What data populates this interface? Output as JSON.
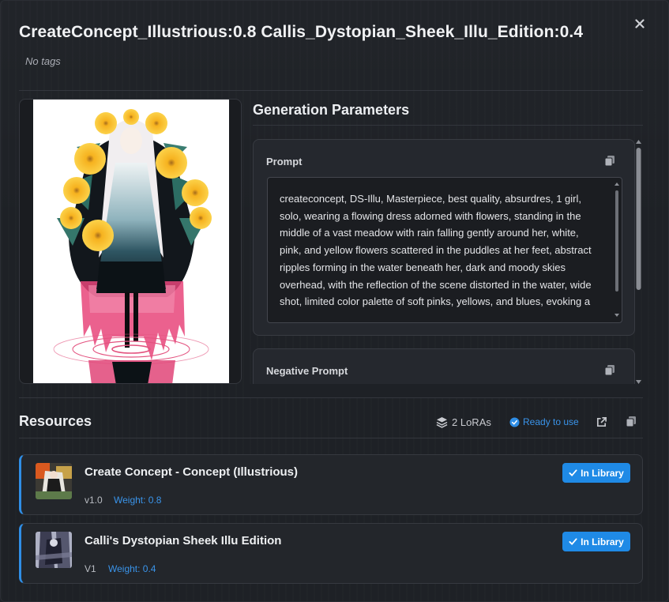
{
  "header": {
    "title": "CreateConcept_Illustrious:0.8 Callis_Dystopian_Sheek_Illu_Edition:0.4",
    "tags_text": "No tags"
  },
  "params": {
    "section_title": "Generation Parameters",
    "prompt_label": "Prompt",
    "prompt_text": "createconcept, DS-Illu, Masterpiece, best quality, absurdres, 1 girl, solo, wearing a flowing dress adorned with flowers, standing in the middle of a vast meadow with rain falling gently around her, white, pink, and yellow flowers scattered in the puddles at her feet, abstract ripples forming in the water beneath her, dark and moody skies overhead, with the reflection of the scene distorted in the water, wide shot, limited color palette of soft pinks, yellows, and blues, evoking a",
    "negative_label": "Negative Prompt"
  },
  "resources": {
    "section_title": "Resources",
    "lora_count": "2 LoRAs",
    "status": "Ready to use",
    "items": [
      {
        "name": "Create Concept - Concept (Illustrious)",
        "version": "v1.0",
        "weight": "Weight: 0.8",
        "library_label": "In Library"
      },
      {
        "name": "Calli's Dystopian Sheek Illu Edition",
        "version": "V1",
        "weight": "Weight: 0.4",
        "library_label": "In Library"
      }
    ]
  },
  "icons": {
    "close": "close-icon",
    "copy": "copy-icon",
    "layers": "layers-icon",
    "check_circle": "check-circle-icon",
    "external_link": "external-link-icon",
    "check": "check-icon"
  },
  "colors": {
    "accent": "#1f8ae6",
    "link": "#3a94ea",
    "background": "#1e2126"
  }
}
